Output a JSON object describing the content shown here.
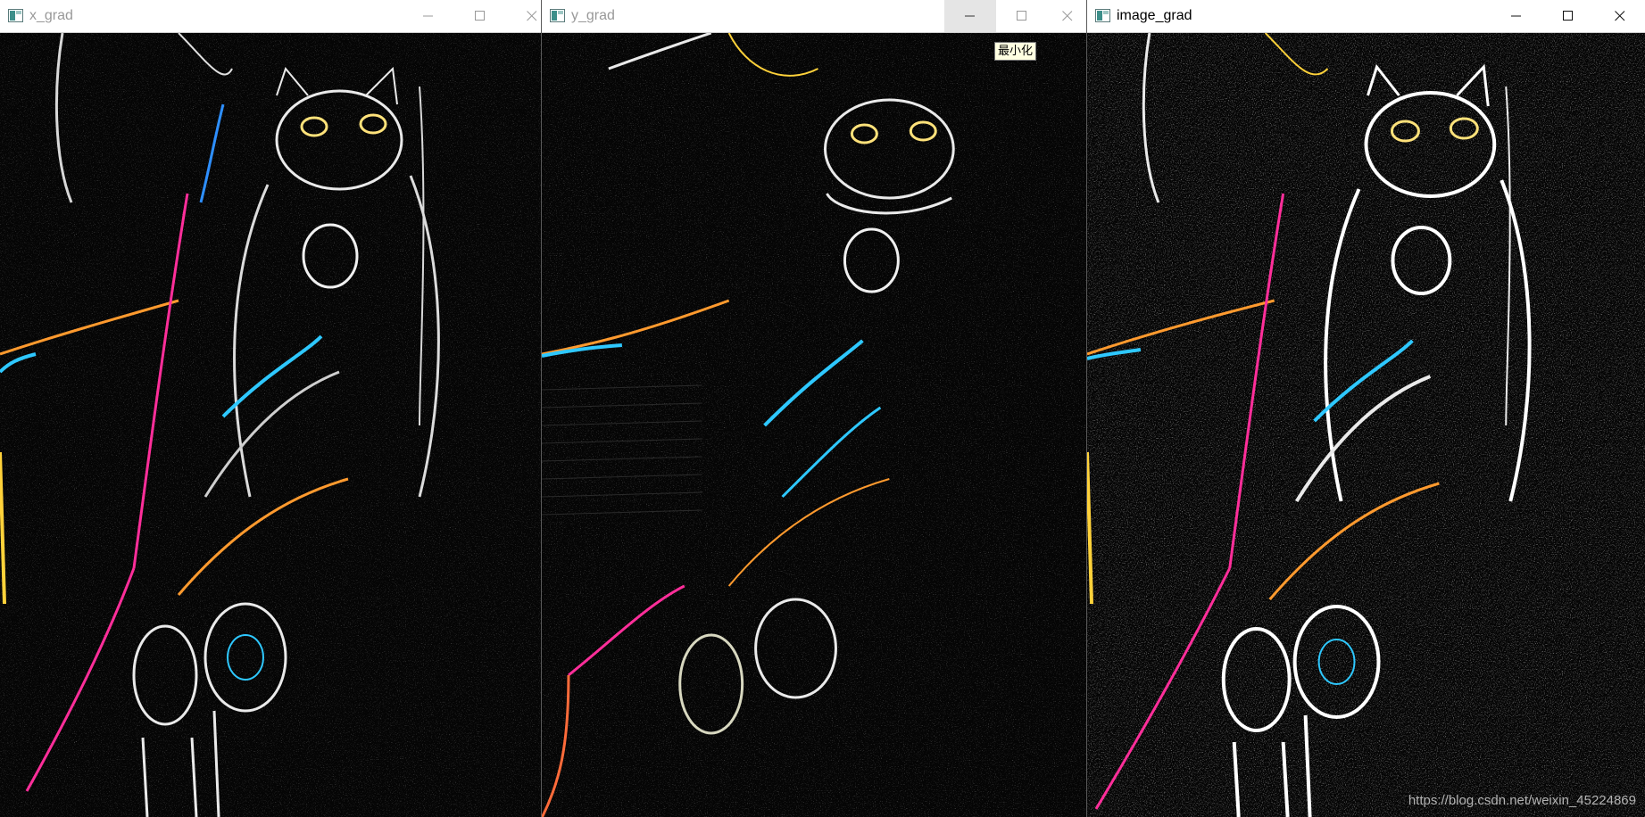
{
  "windows": [
    {
      "id": "x",
      "title": "x_grad",
      "active": false,
      "image": "x-gradient-cat-image"
    },
    {
      "id": "y",
      "title": "y_grad",
      "active": false,
      "image": "y-gradient-cat-image"
    },
    {
      "id": "img",
      "title": "image_grad",
      "active": true,
      "image": "combined-gradient-cat-image"
    }
  ],
  "tooltip": {
    "text": "最小化"
  },
  "watermark": {
    "text": "https://blog.csdn.net/weixin_45224869"
  },
  "icons": {
    "app": "window-app-icon",
    "minimize": "minimize-icon",
    "maximize": "maximize-icon",
    "close": "close-icon"
  },
  "colors": {
    "titlebar": "#ffffff",
    "inactive_title": "#999999",
    "active_title": "#000000",
    "image_background": "#050505",
    "edge_white": "#e8e8e8",
    "edge_orange": "#ff9a2e",
    "edge_magenta": "#ff2e9a",
    "edge_cyan": "#2ec8ff",
    "edge_yellow": "#ffd23a"
  }
}
